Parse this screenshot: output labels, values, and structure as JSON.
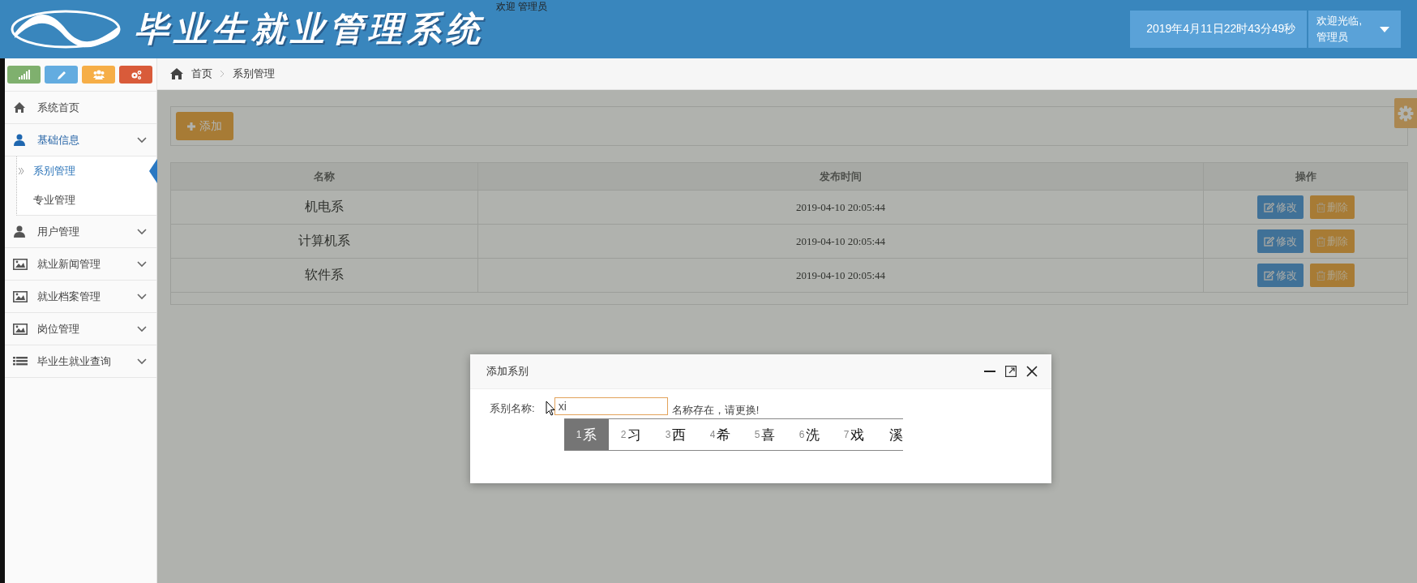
{
  "header": {
    "title": "毕业生就业管理系统",
    "welcome": "欢迎 管理员",
    "datetime": "2019年4月11日22时43分49秒",
    "greeting": "欢迎光临,",
    "user": "管理员"
  },
  "sidebar": {
    "quick_buttons": [
      {
        "color": "#7fb06e"
      },
      {
        "color": "#63ace0"
      },
      {
        "color": "#f6ae47"
      },
      {
        "color": "#d95b3a"
      }
    ],
    "items": [
      {
        "label": "系统首页",
        "kind": "link"
      },
      {
        "label": "基础信息",
        "kind": "group",
        "expanded": true,
        "children": [
          {
            "label": "系别管理",
            "selected": true
          },
          {
            "label": "专业管理",
            "selected": false
          }
        ]
      },
      {
        "label": "用户管理",
        "kind": "group",
        "expanded": false
      },
      {
        "label": "就业新闻管理",
        "kind": "group",
        "expanded": false
      },
      {
        "label": "就业档案管理",
        "kind": "group",
        "expanded": false
      },
      {
        "label": "岗位管理",
        "kind": "group",
        "expanded": false
      },
      {
        "label": "毕业生就业查询",
        "kind": "group",
        "expanded": false
      }
    ]
  },
  "breadcrumb": [
    "首页",
    "系别管理"
  ],
  "toolbar": {
    "add_button": "添加"
  },
  "table": {
    "columns": [
      "名称",
      "发布时间",
      "操作"
    ],
    "rows": [
      {
        "cells": [
          "机电系",
          "2019-04-10 20:05:44"
        ],
        "actions": [
          "修改",
          "删除"
        ]
      },
      {
        "cells": [
          "计算机系",
          "2019-04-10 20:05:44"
        ],
        "actions": [
          "修改",
          "删除"
        ]
      },
      {
        "cells": [
          "软件系",
          "2019-04-10 20:05:44"
        ],
        "actions": [
          "修改",
          "删除"
        ]
      }
    ]
  },
  "dialog": {
    "title": "添加系别",
    "label": "系别名称:",
    "value": "xi",
    "error": "名称存在，请更换!",
    "candidates": [
      {
        "index": "1",
        "text": "系",
        "selected": true
      },
      {
        "index": "2",
        "text": "习",
        "selected": false
      },
      {
        "index": "3",
        "text": "西",
        "selected": false
      },
      {
        "index": "4",
        "text": "希",
        "selected": false
      },
      {
        "index": "5",
        "text": "喜",
        "selected": false
      },
      {
        "index": "6",
        "text": "洗",
        "selected": false
      },
      {
        "index": "7",
        "text": "戏",
        "selected": false
      },
      {
        "text": "溪",
        "selected": false
      }
    ]
  }
}
